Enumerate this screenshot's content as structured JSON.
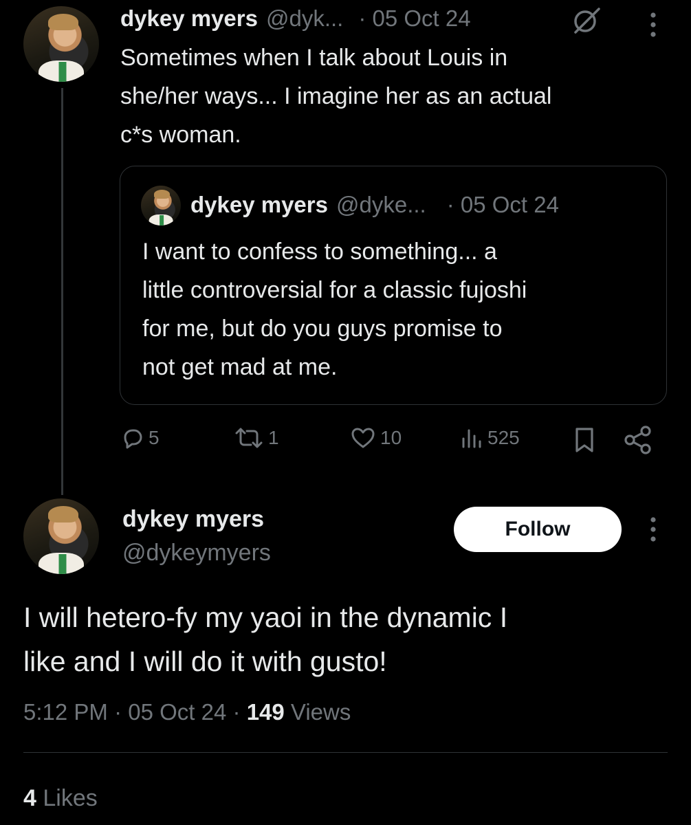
{
  "parent_tweet": {
    "name": "dykey myers",
    "handle": "@dyk...",
    "date": "· 05 Oct 24",
    "text_lines": [
      "Sometimes when I talk about Louis in",
      "she/her ways... I imagine her as an actual",
      "c*s woman."
    ],
    "quoted": {
      "name": "dykey myers",
      "handle": "@dyke...",
      "date": "· 05 Oct 24",
      "text_lines": [
        "I want to confess to something... a",
        "little controversial for a classic fujoshi",
        "for me, but do you guys promise to",
        "not get mad at me."
      ]
    },
    "actions": {
      "replies": "5",
      "reposts": "1",
      "likes": "10",
      "views": "525"
    },
    "icons": [
      "grok-icon",
      "more-icon",
      "reply-icon",
      "repost-icon",
      "like-icon",
      "views-icon",
      "bookmark-icon",
      "share-icon"
    ]
  },
  "main_tweet": {
    "name": "dykey myers",
    "handle": "@dykeymyers",
    "follow_label": "Follow",
    "text_lines": [
      "I will hetero-fy my yaoi in the dynamic I",
      "like and I will do it with gusto!"
    ],
    "meta": {
      "time": "5:12 PM",
      "sep1": "·",
      "date": "05 Oct 24",
      "sep2": "·",
      "views_count": "149",
      "views_label": "Views"
    },
    "likes": {
      "count": "4",
      "label": "Likes"
    }
  },
  "colors": {
    "background": "#000000",
    "text": "#e7e9ea",
    "secondary": "#71767b",
    "border": "#2f3336",
    "follow_bg": "#ffffff"
  }
}
